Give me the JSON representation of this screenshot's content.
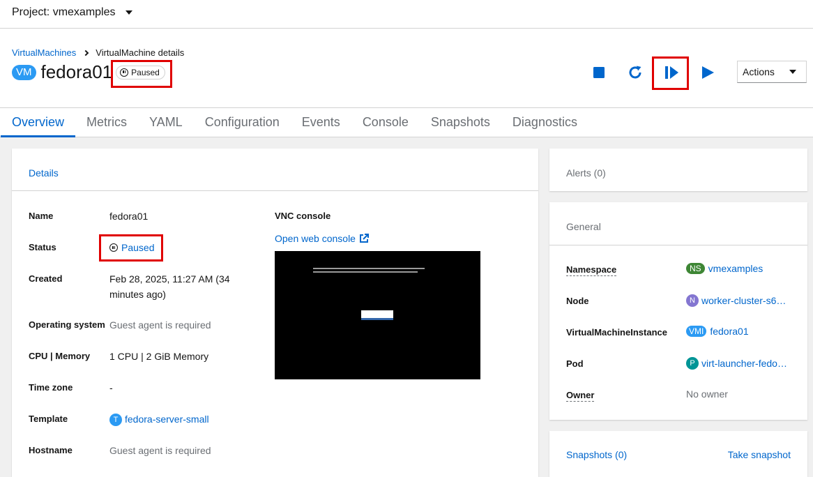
{
  "project": {
    "label": "Project: vmexamples"
  },
  "breadcrumb": {
    "parent": "VirtualMachines",
    "current": "VirtualMachine details"
  },
  "header": {
    "kind_badge": "VM",
    "name": "fedora01",
    "status": "Paused"
  },
  "toolbar": {
    "icons": [
      "stop-icon",
      "restart-icon",
      "unpause-icon",
      "start-icon"
    ],
    "actions_label": "Actions"
  },
  "tabs": [
    "Overview",
    "Metrics",
    "YAML",
    "Configuration",
    "Events",
    "Console",
    "Snapshots",
    "Diagnostics"
  ],
  "details": {
    "heading": "Details",
    "name_label": "Name",
    "name_value": "fedora01",
    "status_label": "Status",
    "status_value": "Paused",
    "created_label": "Created",
    "created_value": "Feb 28, 2025, 11:27 AM (34 minutes ago)",
    "os_label": "Operating system",
    "os_value": "Guest agent is required",
    "cpu_label": "CPU | Memory",
    "cpu_value": "1 CPU | 2 GiB Memory",
    "tz_label": "Time zone",
    "tz_value": "-",
    "template_label": "Template",
    "template_badge": "T",
    "template_value": "fedora-server-small",
    "hostname_label": "Hostname",
    "hostname_value": "Guest agent is required",
    "vnc_title": "VNC console",
    "vnc_open": "Open web console"
  },
  "alerts": {
    "heading": "Alerts (0)"
  },
  "general": {
    "heading": "General",
    "namespace_label": "Namespace",
    "namespace_badge": "NS",
    "namespace_value": "vmexamples",
    "node_label": "Node",
    "node_badge": "N",
    "node_value": "worker-cluster-s6…",
    "vmi_label": "VirtualMachineInstance",
    "vmi_badge": "VMI",
    "vmi_value": "fedora01",
    "pod_label": "Pod",
    "pod_badge": "P",
    "pod_value": "virt-launcher-fedo…",
    "owner_label": "Owner",
    "owner_value": "No owner"
  },
  "snapshots": {
    "heading": "Snapshots (0)",
    "take": "Take snapshot"
  },
  "colors": {
    "link": "#0066cc",
    "highlight": "#e00000",
    "vm_badge": "#2b9af3",
    "ns_badge": "#3e8635",
    "node_badge": "#8476d1",
    "pod_badge": "#009596",
    "template_badge": "#2b9af3"
  }
}
